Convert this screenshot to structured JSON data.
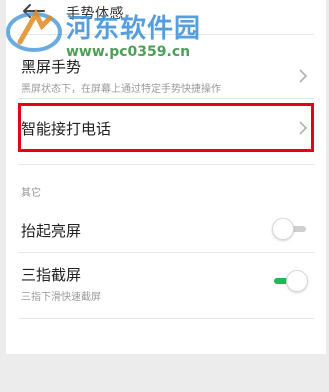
{
  "header": {
    "title": "手势体感"
  },
  "watermark": {
    "site_name": "河东软件园",
    "url": "www.pc0359.cn"
  },
  "items": {
    "black_screen": {
      "label": "黑屏手势",
      "subtitle": "黑屏状态下，在屏幕上通过特定手势快捷操作"
    },
    "smart_answer": {
      "label": "智能接打电话"
    }
  },
  "sections": {
    "other": "其它"
  },
  "toggles": {
    "raise_wake": {
      "label": "抬起亮屏",
      "enabled": false
    },
    "three_finger": {
      "label": "三指截屏",
      "subtitle": "三指下滑快速截屏",
      "enabled": true
    }
  },
  "colors": {
    "toggle_on": "#1db954",
    "toggle_off": "#cfcfcf",
    "highlight": "#e3001b"
  }
}
